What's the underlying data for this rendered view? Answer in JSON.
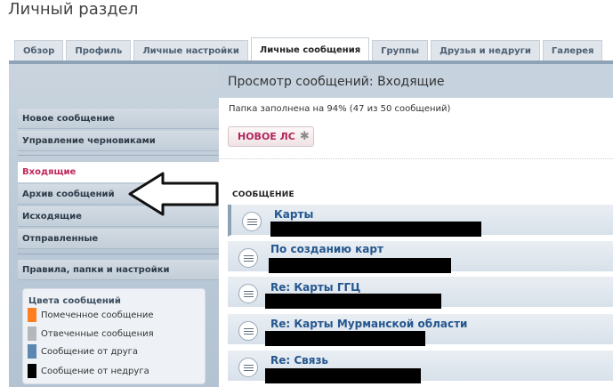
{
  "page": {
    "title": "Личный раздел"
  },
  "tabs": [
    {
      "label": "Обзор",
      "active": false
    },
    {
      "label": "Профиль",
      "active": false
    },
    {
      "label": "Личные настройки",
      "active": false
    },
    {
      "label": "Личные сообщения",
      "active": true
    },
    {
      "label": "Группы",
      "active": false
    },
    {
      "label": "Друзья и недруги",
      "active": false
    },
    {
      "label": "Галерея",
      "active": false
    }
  ],
  "main": {
    "header": "Просмотр сообщений: Входящие",
    "usage": "Папка заполнена на 94% (47 из 50 сообщений)",
    "new_button": "НОВОЕ ЛС",
    "new_button_icon": "star-icon",
    "column_header": "СООБЩЕНИЕ"
  },
  "sidebar": {
    "items": [
      {
        "label": "Новое сообщение"
      },
      {
        "label": "Управление черновиками"
      },
      {
        "label": "Входящие",
        "active": true
      },
      {
        "label": "Архив сообщений"
      },
      {
        "label": "Исходящие"
      },
      {
        "label": "Отправленные"
      },
      {
        "label": "Правила, папки и настройки"
      }
    ],
    "legend": {
      "title": "Цвета сообщений",
      "entries": [
        {
          "label": "Помеченное сообщение",
          "color": "#ff7f1f"
        },
        {
          "label": "Отвеченные сообщения",
          "color": "#b3b8bd"
        },
        {
          "label": "Сообщение от друга",
          "color": "#5c87b2"
        },
        {
          "label": "Сообщение от недруга",
          "color": "#000000"
        }
      ]
    }
  },
  "messages": [
    {
      "subject": "Карты",
      "icon": "message-icon"
    },
    {
      "subject": "По созданию карт",
      "icon": "message-icon"
    },
    {
      "subject": "Re: Карты ГГЦ",
      "icon": "message-icon"
    },
    {
      "subject": "Re: Карты Мурманской области",
      "icon": "message-icon"
    },
    {
      "subject": "Re: Связь",
      "icon": "message-icon"
    }
  ],
  "annotation": {
    "icon": "arrow-left-icon"
  },
  "colors": {
    "accent": "#c0265a",
    "link": "#24568e",
    "panel": "#c6d3df"
  }
}
